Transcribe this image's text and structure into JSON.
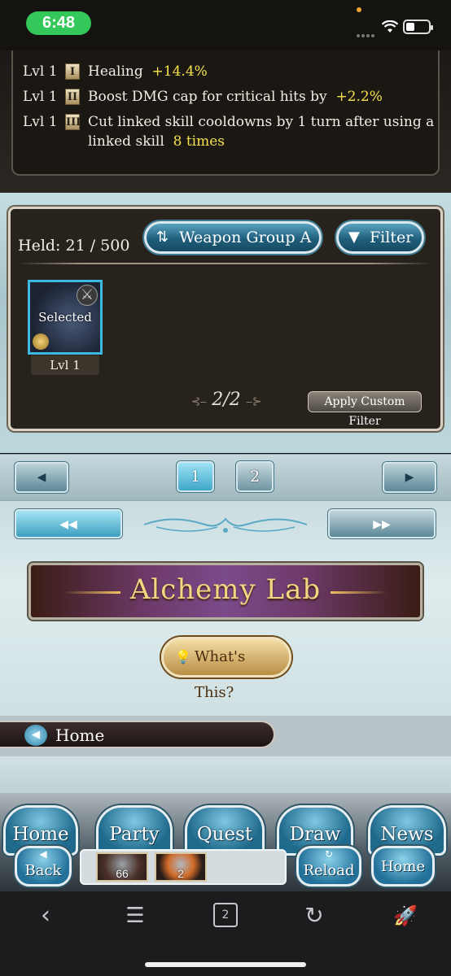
{
  "status_bar": {
    "time": "6:48"
  },
  "skills": [
    {
      "level": "Lvl 1",
      "roman": "I",
      "text": "Healing",
      "value": "+14.4%"
    },
    {
      "level": "Lvl 1",
      "roman": "II",
      "text": "Boost DMG cap for critical hits by",
      "value": "+2.2%"
    },
    {
      "level": "Lvl 1",
      "roman": "III",
      "text": "Cut linked skill cooldowns by 1 turn after using a linked skill",
      "value": "8 times"
    }
  ],
  "inventory": {
    "held": "Held: 21 / 500",
    "weapon_group_label": "Weapon Group A",
    "filter_label": "Filter",
    "weapon_card": {
      "state": "Selected",
      "level": "Lvl 1"
    },
    "page_indicator": "2/2",
    "custom_filter_label": "Apply Custom Filter"
  },
  "pagination": {
    "pages": [
      "1",
      "2"
    ],
    "current": "1"
  },
  "alchemy_banner": "Alchemy Lab",
  "whats_this_label": "What's This?",
  "breadcrumb_home": "Home",
  "game_nav": {
    "items": [
      "Home",
      "Party",
      "Quest",
      "Draw",
      "News"
    ],
    "back": "Back",
    "reload": "Reload",
    "home": "Home",
    "thumb_counts": [
      "66",
      "2"
    ]
  },
  "browser_toolbar": {
    "tab_count": "2"
  },
  "colors": {
    "highlight": "#f5e14b",
    "selected_border": "#3db8e0",
    "status_green": "#34c759"
  }
}
